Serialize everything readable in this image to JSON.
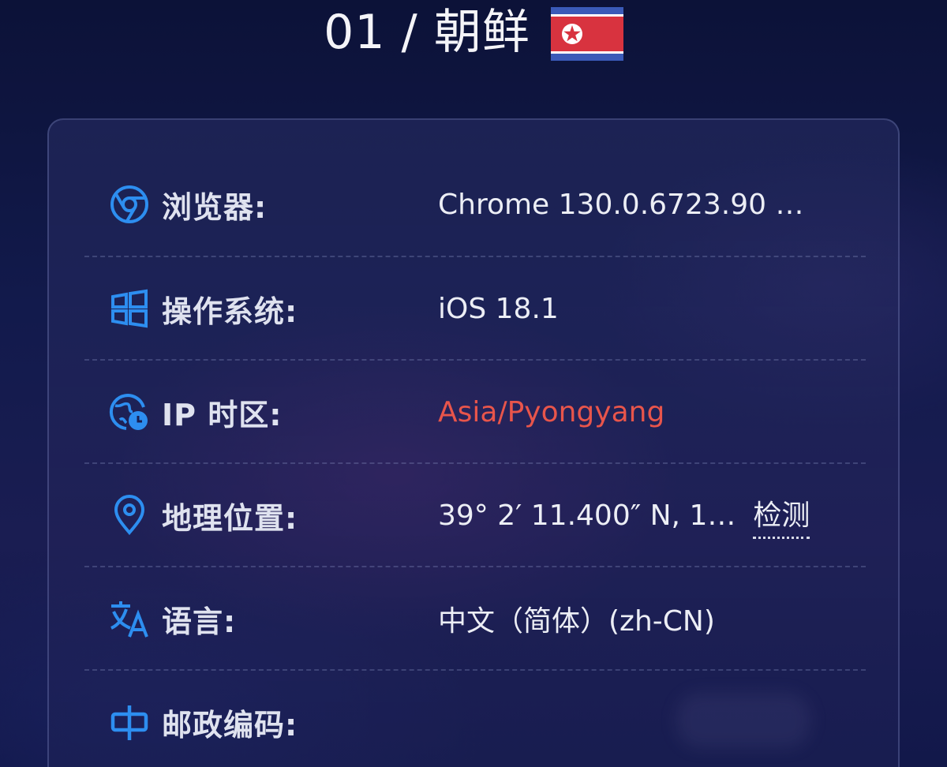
{
  "header": {
    "title": "01 / 朝鲜",
    "flag_icon": "north-korea-flag",
    "flag_colors": {
      "blue": "#3a5ab8",
      "red": "#d8333f",
      "white": "#ffffff",
      "star": "#d8333f"
    }
  },
  "rows": [
    {
      "icon": "chrome-icon",
      "label": "浏览器:",
      "value": "Chrome 130.0.6723.90  …"
    },
    {
      "icon": "windows-icon",
      "label": "操作系统:",
      "value": "iOS 18.1"
    },
    {
      "icon": "globe-clock-icon",
      "label": "IP 时区:",
      "value": "Asia/Pyongyang",
      "value_color": "#e8554b"
    },
    {
      "icon": "location-pin-icon",
      "label": "地理位置:",
      "value": "39° 2′ 11.400″ N, 1…",
      "action": "检测"
    },
    {
      "icon": "translate-icon",
      "label": "语言:",
      "value": "中文（简体）(zh-CN)"
    },
    {
      "icon": "postal-code-icon",
      "label": "邮政编码:",
      "value": ""
    }
  ],
  "accent_color": "#2d8ef0"
}
